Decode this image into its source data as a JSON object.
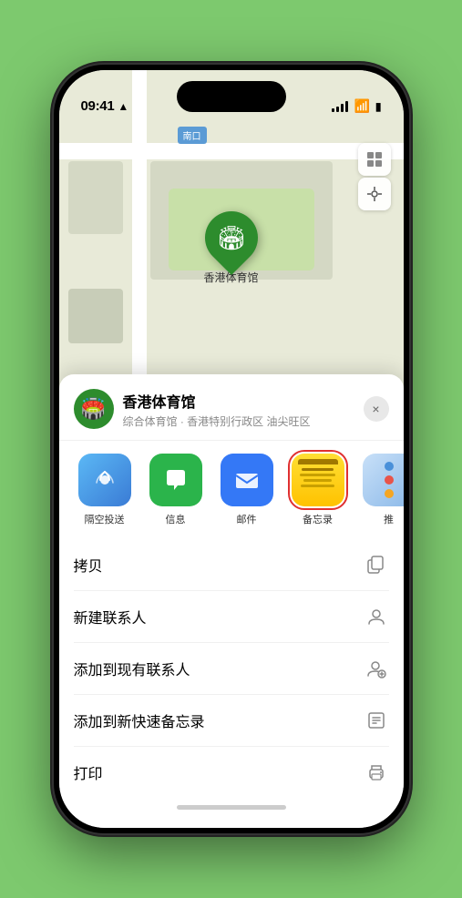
{
  "status": {
    "time": "09:41",
    "location_arrow": "▶"
  },
  "map": {
    "label": "南口",
    "pin_label": "香港体育馆"
  },
  "venue": {
    "name": "香港体育馆",
    "description": "综合体育馆 · 香港特别行政区 油尖旺区",
    "icon": "🏟️"
  },
  "share_items": [
    {
      "id": "airdrop",
      "label": "隔空投送",
      "selected": false
    },
    {
      "id": "messages",
      "label": "信息",
      "selected": false
    },
    {
      "id": "mail",
      "label": "邮件",
      "selected": false
    },
    {
      "id": "notes",
      "label": "备忘录",
      "selected": true
    },
    {
      "id": "more",
      "label": "推",
      "selected": false
    }
  ],
  "actions": [
    {
      "id": "copy",
      "label": "拷贝",
      "icon": "copy"
    },
    {
      "id": "new-contact",
      "label": "新建联系人",
      "icon": "person"
    },
    {
      "id": "add-existing",
      "label": "添加到现有联系人",
      "icon": "person-add"
    },
    {
      "id": "add-note",
      "label": "添加到新快速备忘录",
      "icon": "note"
    },
    {
      "id": "print",
      "label": "打印",
      "icon": "printer"
    }
  ],
  "close_label": "×"
}
